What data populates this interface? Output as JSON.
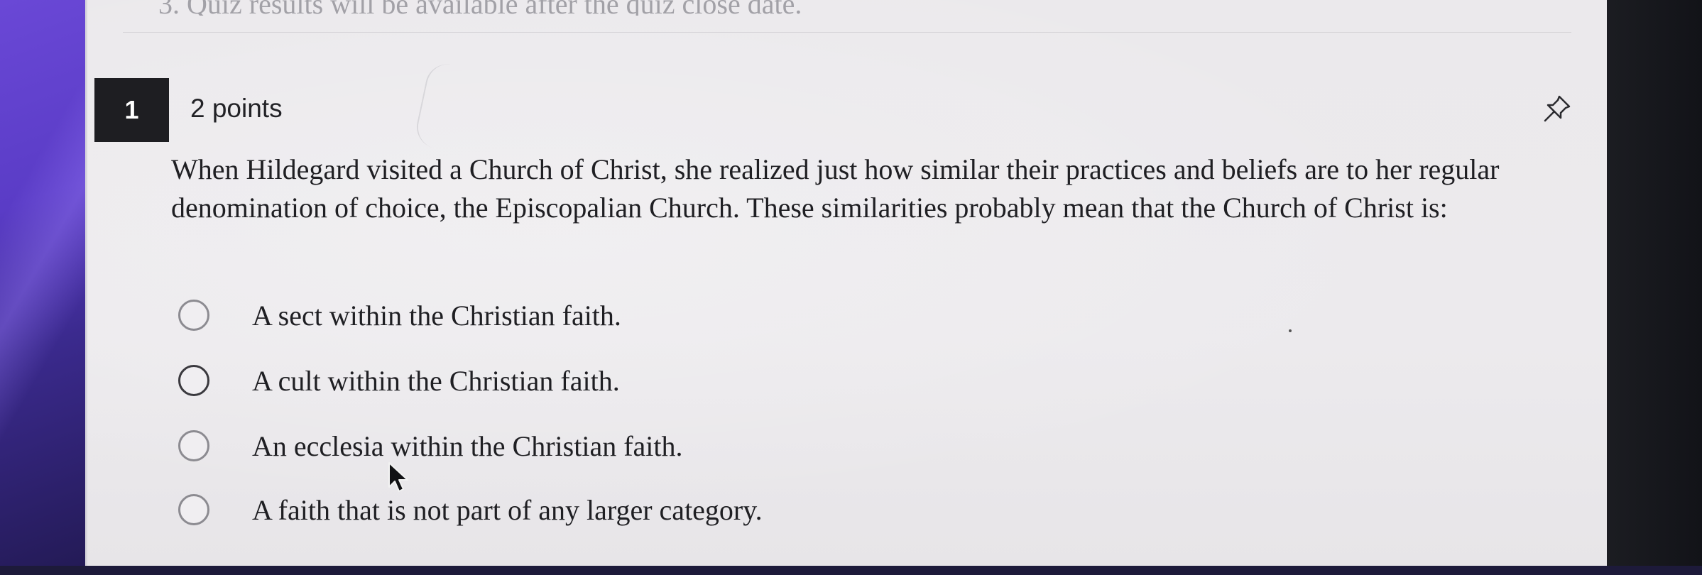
{
  "banner": {
    "text": "3. Quiz results will be available after the quiz close date."
  },
  "question": {
    "number": "1",
    "points": "2 points",
    "text": "When Hildegard visited a Church of Christ, she realized just how similar their practices and beliefs are to her regular denomination of choice, the Episcopalian Church. These similarities probably mean that the Church of Christ is:",
    "options": [
      {
        "label": "A sect within the Christian faith."
      },
      {
        "label": "A cult within the Christian faith."
      },
      {
        "label": "An ecclesia within the Christian faith."
      },
      {
        "label": "A faith that is not part of any larger category."
      }
    ]
  },
  "icons": {
    "pin": "pin-icon",
    "cursor": "mouse-pointer-icon"
  },
  "colors": {
    "number_badge_bg": "#1e1e22",
    "page_bg": "#ebe9ec",
    "text": "#1f1f23",
    "wallpaper_accent": "#5a3cc6"
  }
}
